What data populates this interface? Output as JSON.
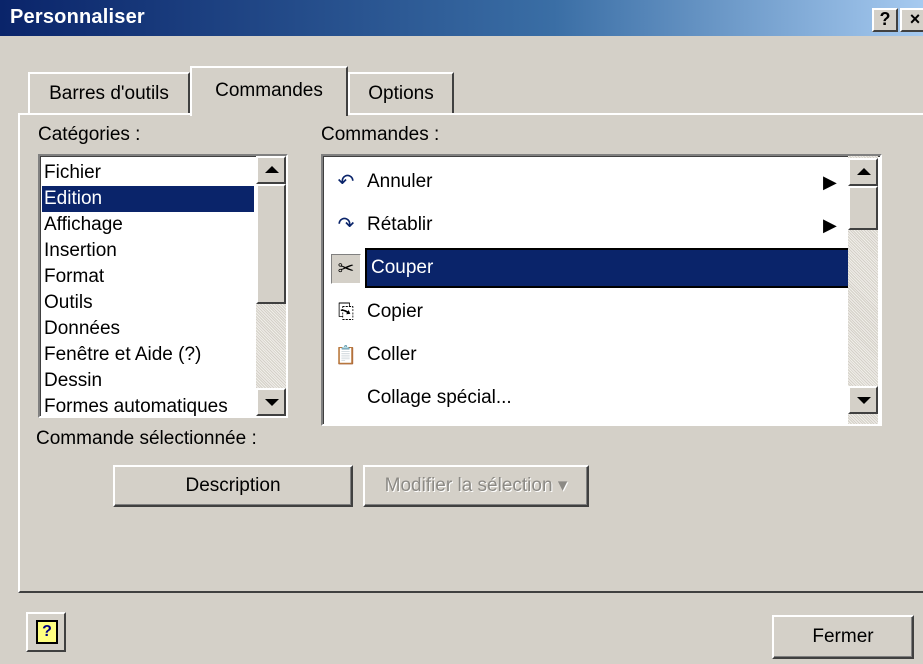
{
  "window": {
    "title": "Personnaliser",
    "help_glyph": "?",
    "close_glyph": "×"
  },
  "tabs": [
    {
      "label": "Barres d'outils"
    },
    {
      "label": "Commandes",
      "active": true
    },
    {
      "label": "Options"
    }
  ],
  "categories": {
    "label": "Catégories :",
    "items": [
      "Fichier",
      "Edition",
      "Affichage",
      "Insertion",
      "Format",
      "Outils",
      "Données",
      "Fenêtre et Aide (?)",
      "Dessin",
      "Formes automatiques"
    ],
    "selected": "Edition"
  },
  "commands": {
    "label": "Commandes :",
    "items": [
      {
        "label": "Annuler",
        "icon": "undo-icon",
        "glyph": "↶",
        "has_submenu": true
      },
      {
        "label": "Rétablir",
        "icon": "redo-icon",
        "glyph": "↷",
        "has_submenu": true
      },
      {
        "label": "Couper",
        "icon": "scissors-icon",
        "glyph": "✂",
        "has_submenu": false,
        "selected": true
      },
      {
        "label": "Copier",
        "icon": "copy-icon",
        "glyph": "⎘",
        "has_submenu": false
      },
      {
        "label": "Coller",
        "icon": "paste-icon",
        "glyph": "📋",
        "has_submenu": false
      },
      {
        "label": "Collage spécial...",
        "icon": "",
        "glyph": "",
        "has_submenu": false
      }
    ]
  },
  "selected_command": {
    "label": "Commande sélectionnée :",
    "description_button": "Description",
    "modify_button": "Modifier la sélection ▾"
  },
  "footer": {
    "help_glyph": "?",
    "close_button": "Fermer"
  },
  "colors": {
    "selection": "#0a246a",
    "face": "#d4d0c8",
    "title_start": "#0a246a",
    "title_end": "#a6caf0"
  }
}
